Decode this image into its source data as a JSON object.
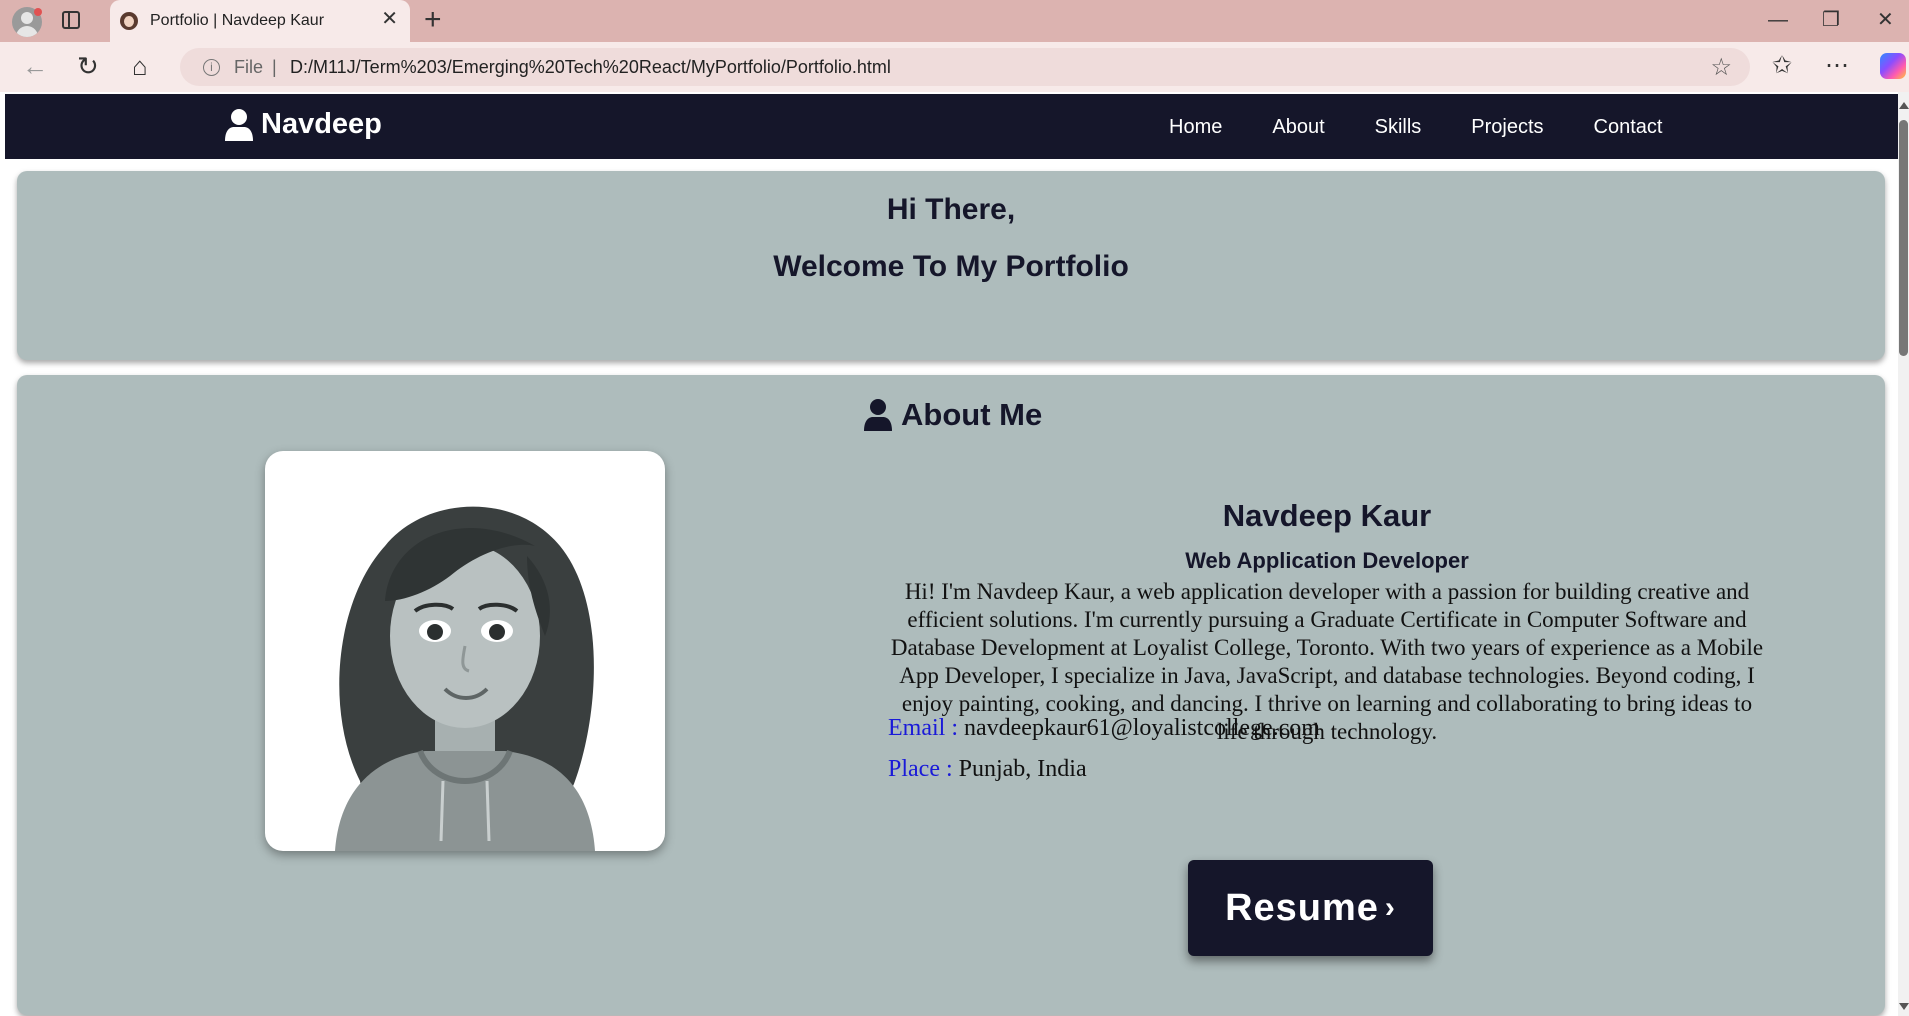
{
  "browser": {
    "tab_title": "Portfolio | Navdeep Kaur",
    "tab_close": "✕",
    "new_tab": "+",
    "file_label": "File",
    "separator": "|",
    "url": "D:/M11J/Term%203/Emerging%20Tech%20React/MyPortfolio/Portfolio.html",
    "window_buttons": {
      "minimize": "—",
      "restore": "❐",
      "close": "✕"
    },
    "icons": [
      "back-icon",
      "refresh-icon",
      "home-icon",
      "info-icon",
      "star-icon",
      "favorites-icon",
      "more-icon",
      "copilot-icon"
    ]
  },
  "nav": {
    "brand": "Navdeep",
    "items": [
      "Home",
      "About",
      "Skills",
      "Projects",
      "Contact"
    ]
  },
  "hero": {
    "line1": "Hi There,",
    "line2": "Welcome To My Portfolio"
  },
  "about": {
    "title": "About Me",
    "name": "Navdeep Kaur",
    "role": "Web Application Developer",
    "bio": "Hi! I'm Navdeep Kaur, a web application developer with a passion for building creative and efficient solutions. I'm currently pursuing a Graduate Certificate in Computer Software and Database Development at Loyalist College, Toronto. With two years of experience as a Mobile App Developer, I specialize in Java, JavaScript, and database technologies. Beyond coding, I enjoy painting, cooking, and dancing. I thrive on learning and collaborating to bring ideas to life through technology.",
    "email_label": "Email :",
    "email": "navdeepkaur61@loyalistcollege.com",
    "place_label": "Place :",
    "place": "Punjab, India",
    "resume_label": "Resume",
    "resume_chevron": "›"
  },
  "colors": {
    "navbar": "#15162a",
    "card": "#aebcbc",
    "label_blue": "#1a1ad8",
    "tabbar": "#dcb3b0",
    "toolbar": "#f7eae9"
  }
}
